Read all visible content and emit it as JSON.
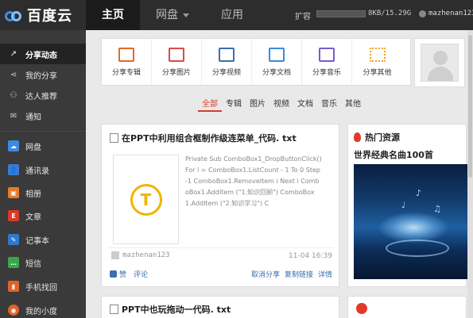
{
  "app": {
    "logo_text": "百度云"
  },
  "topnav": {
    "items": [
      {
        "label": "主页",
        "active": true
      },
      {
        "label": "网盘",
        "active": false,
        "has_caret": true
      },
      {
        "label": "应用",
        "active": false
      }
    ]
  },
  "status": {
    "capacity_label": "扩容",
    "capacity_value": "8KB/15.29G",
    "capacity_fraction": 0.0,
    "username": "mazhenan123"
  },
  "sidebar": {
    "items": [
      {
        "label": "分享动态",
        "icon": "activity-icon",
        "active": true
      },
      {
        "label": "我的分享",
        "icon": "share-icon",
        "active": false
      },
      {
        "label": "达人推荐",
        "icon": "people-icon",
        "active": false
      },
      {
        "label": "通知",
        "icon": "mail-icon",
        "active": false
      },
      {
        "label": "网盘",
        "icon": "cloud-icon",
        "active": false
      },
      {
        "label": "通讯录",
        "icon": "contacts-icon",
        "active": false
      },
      {
        "label": "相册",
        "icon": "photo-album-icon",
        "active": false
      },
      {
        "label": "文章",
        "icon": "article-icon",
        "active": false
      },
      {
        "label": "记事本",
        "icon": "notepad-icon",
        "active": false
      },
      {
        "label": "短信",
        "icon": "sms-icon",
        "active": false
      },
      {
        "label": "手机找回",
        "icon": "phone-find-icon",
        "active": false
      },
      {
        "label": "我的小度",
        "icon": "xiaodu-icon",
        "active": false
      }
    ]
  },
  "share_panel": {
    "buttons": [
      {
        "label": "分享专辑",
        "icon": "album-icon"
      },
      {
        "label": "分享图片",
        "icon": "image-icon"
      },
      {
        "label": "分享视频",
        "icon": "video-icon"
      },
      {
        "label": "分享文档",
        "icon": "document-icon"
      },
      {
        "label": "分享音乐",
        "icon": "music-icon"
      },
      {
        "label": "分享其他",
        "icon": "more-icon"
      }
    ]
  },
  "filters": [
    "全部",
    "专辑",
    "图片",
    "视频",
    "文档",
    "音乐",
    "其他"
  ],
  "feed": {
    "card1": {
      "title": "在PPT中利用组合框制作级连菜单_代码. txt",
      "thumb_letter": "T",
      "code_lines": [
        "Private Sub ComboBox1_DropButtonClick()",
        "For i = ComboBox1.ListCount - 1 To 0 Step",
        "-1 ComboBox1.RemoveItem i Next i Comb",
        "oBox1.AddItem (\"1.知识回顾\") ComboBox",
        "1.AddItem (\"2.知识学习\") C"
      ],
      "user": "mazhenan123",
      "date": "11-04 16:39",
      "like_label": "赞",
      "comment_label": "评论",
      "actions": [
        "取消分享",
        "复制链接",
        "详情"
      ]
    },
    "card2": {
      "title": "PPT中也玩拖动一代码. txt"
    }
  },
  "hot": {
    "heading": "热门资源",
    "title": "世界经典名曲100首"
  }
}
